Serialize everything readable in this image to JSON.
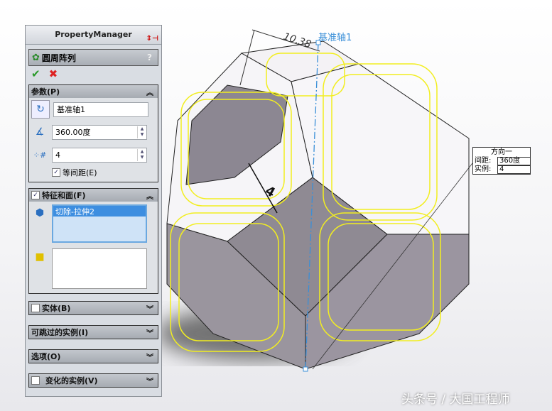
{
  "panel": {
    "title": "PropertyManager",
    "feature_title": "圆周阵列",
    "help": "?"
  },
  "params": {
    "title": "参数(P)",
    "axis": "基准轴1",
    "angle": "360.00度",
    "count": "4",
    "equal_spacing": "等间距(E)"
  },
  "features": {
    "title": "特征和面(F)",
    "items": [
      "切除-拉伸2"
    ]
  },
  "collapsed": [
    {
      "title": "实体(B)",
      "checkbox": true
    },
    {
      "title": "可跳过的实例(I)",
      "checkbox": false
    },
    {
      "title": "选项(O)",
      "checkbox": false
    },
    {
      "title": "变化的实例(V)",
      "checkbox": true
    }
  ],
  "viewport": {
    "axis_label": "基准轴1",
    "dim_label": "10.38",
    "dim2": "4"
  },
  "callout": {
    "title": "方向一",
    "spacing_label": "间距:",
    "spacing": "360度",
    "instances_label": "实例:",
    "instances": "4"
  },
  "watermark": "头条号 / 大国工程师"
}
